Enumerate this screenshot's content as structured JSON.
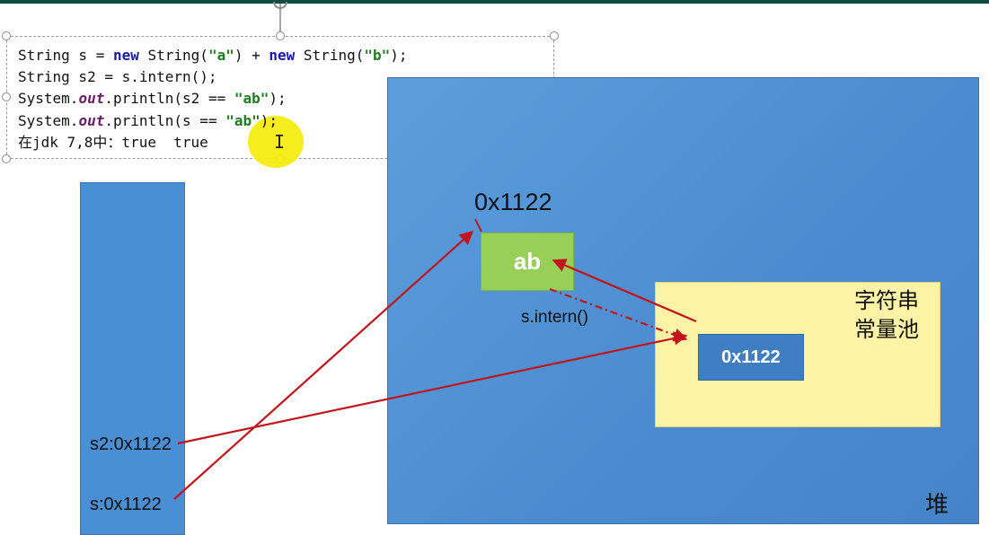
{
  "code_lines": [
    [
      {
        "t": "String s = ",
        "c": ""
      },
      {
        "t": "new",
        "c": "kw"
      },
      {
        "t": " String(",
        "c": ""
      },
      {
        "t": "\"a\"",
        "c": "str"
      },
      {
        "t": ") + ",
        "c": ""
      },
      {
        "t": "new",
        "c": "kw"
      },
      {
        "t": " String(",
        "c": ""
      },
      {
        "t": "\"b\"",
        "c": "str"
      },
      {
        "t": ");",
        "c": ""
      }
    ],
    [
      {
        "t": "String s2 = s.intern();",
        "c": ""
      }
    ],
    [
      {
        "t": "System.",
        "c": ""
      },
      {
        "t": "out",
        "c": "fld"
      },
      {
        "t": ".println(s2 == ",
        "c": ""
      },
      {
        "t": "\"ab\"",
        "c": "str"
      },
      {
        "t": ");",
        "c": ""
      }
    ],
    [
      {
        "t": "System.",
        "c": ""
      },
      {
        "t": "out",
        "c": "fld"
      },
      {
        "t": ".println(s == ",
        "c": ""
      },
      {
        "t": "\"ab\"",
        "c": "str"
      },
      {
        "t": ");",
        "c": ""
      }
    ],
    [
      {
        "t": "在jdk 7,8中：true  true",
        "c": ""
      }
    ]
  ],
  "labels": {
    "heap_addr": "0x1122",
    "ab_value": "ab",
    "intern_call": "s.intern()",
    "pool_title_line1": "字符串",
    "pool_title_line2": "常量池",
    "pool_ref": "0x1122",
    "heap_title": "堆",
    "stack_s2": "s2:0x1122",
    "stack_s": "s:0x1122"
  },
  "colors": {
    "arrow": "#c3161c",
    "heap": "#4a8bcf",
    "pool": "#fdf3a6",
    "ab_box": "#98cf58"
  }
}
